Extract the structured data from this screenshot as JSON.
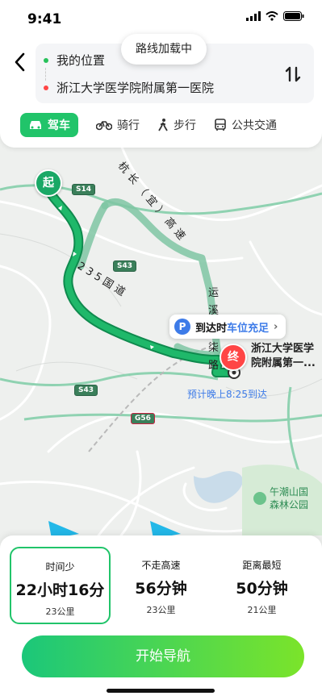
{
  "status_bar": {
    "time": "9:41"
  },
  "route": {
    "from_label": "我的位置",
    "to_label": "浙江大学医学院附属第一医院",
    "loading_text": "路线加载中"
  },
  "modes": [
    {
      "label": "驾车",
      "icon": "car-icon",
      "active": true
    },
    {
      "label": "骑行",
      "icon": "bike-icon",
      "active": false
    },
    {
      "label": "步行",
      "icon": "walk-icon",
      "active": false
    },
    {
      "label": "公共交通",
      "icon": "bus-icon",
      "active": false
    }
  ],
  "map": {
    "start_marker": "起",
    "end_marker": "终",
    "highway_badges": [
      "S14",
      "S43",
      "S43",
      "G56"
    ],
    "road_labels": {
      "hangchangyi": "杭长（宜）高速",
      "yun": "运",
      "xi": "溪",
      "yi": "柒",
      "lu": "路",
      "national_road": "235国道"
    },
    "end_label_line1": "浙江大学医学",
    "end_label_line2": "院附属第一...",
    "eta": "预计晚上8:25到达",
    "parking_prefix": "到达时",
    "parking_highlight": "车位充足",
    "parking_icon": "P",
    "poi_line1": "午潮山国",
    "poi_line2": "森林公园"
  },
  "options": [
    {
      "tag": "时间少",
      "duration": "22小时16分",
      "distance": "23公里",
      "selected": true
    },
    {
      "tag": "不走高速",
      "duration": "56分钟",
      "distance": "23公里",
      "selected": false
    },
    {
      "tag": "距离最短",
      "duration": "50分钟",
      "distance": "21公里",
      "selected": false
    }
  ],
  "start_button": "开始导航",
  "colors": {
    "accent": "#21c46a",
    "route": "#1aa866",
    "link": "#3d7be8",
    "end": "#ff4545"
  }
}
